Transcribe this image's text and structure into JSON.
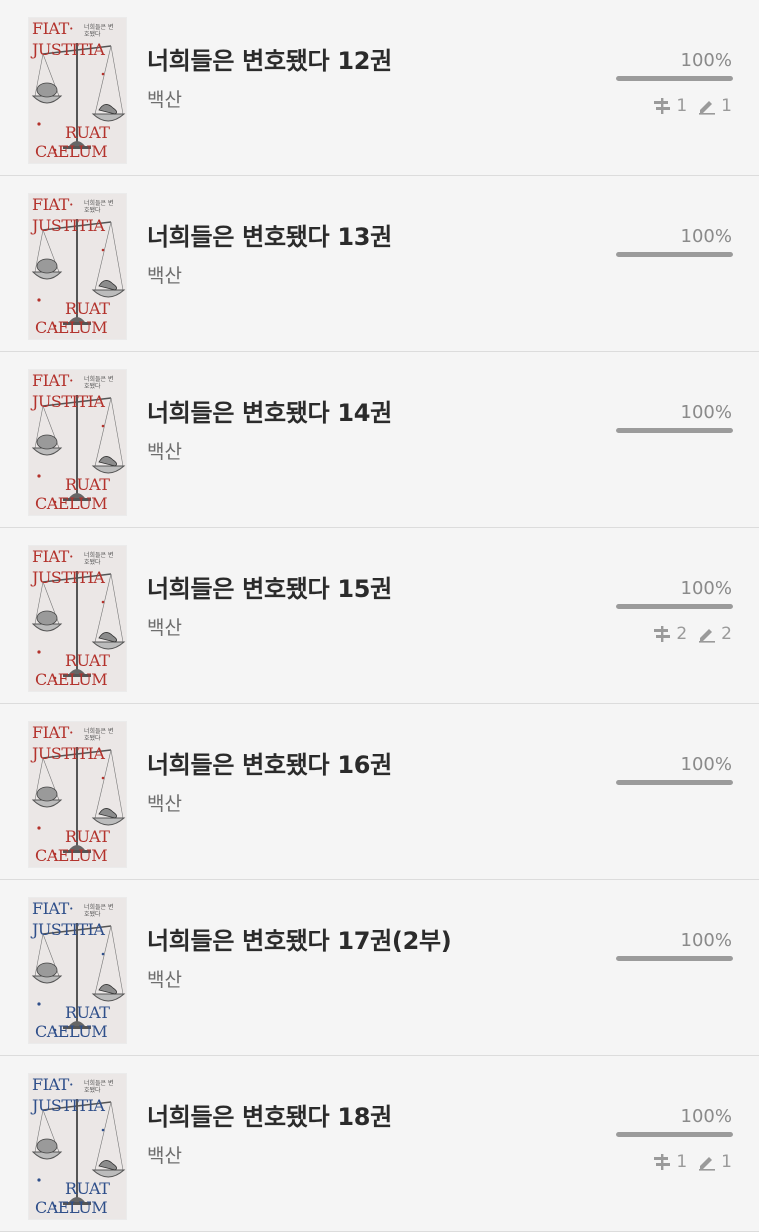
{
  "books": [
    {
      "title": "너희들은 변호됐다 12권",
      "author": "백산",
      "percent_label": "100%",
      "progress": 1.0,
      "has_counts": true,
      "bookmarks": "1",
      "notes": "1",
      "accent": "#b3322c",
      "cover_words": [
        "FIAT·",
        "JUSTITIA",
        "RUAT",
        "CAELUM"
      ],
      "cover_caption": "너희들은 변호됐다"
    },
    {
      "title": "너희들은 변호됐다 13권",
      "author": "백산",
      "percent_label": "100%",
      "progress": 1.0,
      "has_counts": false,
      "accent": "#b3322c",
      "cover_words": [
        "FIAT·",
        "JUSTITIA",
        "RUAT",
        "CAELUM"
      ],
      "cover_caption": "너희들은 변호됐다"
    },
    {
      "title": "너희들은 변호됐다 14권",
      "author": "백산",
      "percent_label": "100%",
      "progress": 1.0,
      "has_counts": false,
      "accent": "#b3322c",
      "cover_words": [
        "FIAT·",
        "JUSTITIA",
        "RUAT",
        "CAELUM"
      ],
      "cover_caption": "너희들은 변호됐다"
    },
    {
      "title": "너희들은 변호됐다 15권",
      "author": "백산",
      "percent_label": "100%",
      "progress": 1.0,
      "has_counts": true,
      "bookmarks": "2",
      "notes": "2",
      "accent": "#b3322c",
      "cover_words": [
        "FIAT·",
        "JUSTITIA",
        "RUAT",
        "CAELUM"
      ],
      "cover_caption": "너희들은 변호됐다"
    },
    {
      "title": "너희들은 변호됐다 16권",
      "author": "백산",
      "percent_label": "100%",
      "progress": 1.0,
      "has_counts": false,
      "accent": "#b3322c",
      "cover_words": [
        "FIAT·",
        "JUSTITIA",
        "RUAT",
        "CAELUM"
      ],
      "cover_caption": "너희들은 변호됐다"
    },
    {
      "title": "너희들은 변호됐다 17권(2부)",
      "author": "백산",
      "percent_label": "100%",
      "progress": 1.0,
      "has_counts": false,
      "accent": "#2f4f8a",
      "cover_words": [
        "FIAT·",
        "JUSTITIA",
        "RUAT",
        "CAELUM"
      ],
      "cover_caption": "너희들은 변호됐다"
    },
    {
      "title": "너희들은 변호됐다 18권",
      "author": "백산",
      "percent_label": "100%",
      "progress": 1.0,
      "has_counts": true,
      "bookmarks": "1",
      "notes": "1",
      "accent": "#2f4f8a",
      "cover_words": [
        "FIAT·",
        "JUSTITIA",
        "RUAT",
        "CAELUM"
      ],
      "cover_caption": "너희들은 변호됐다"
    }
  ],
  "icons": {
    "bookmark": "highlight-icon",
    "note": "pencil-icon"
  }
}
